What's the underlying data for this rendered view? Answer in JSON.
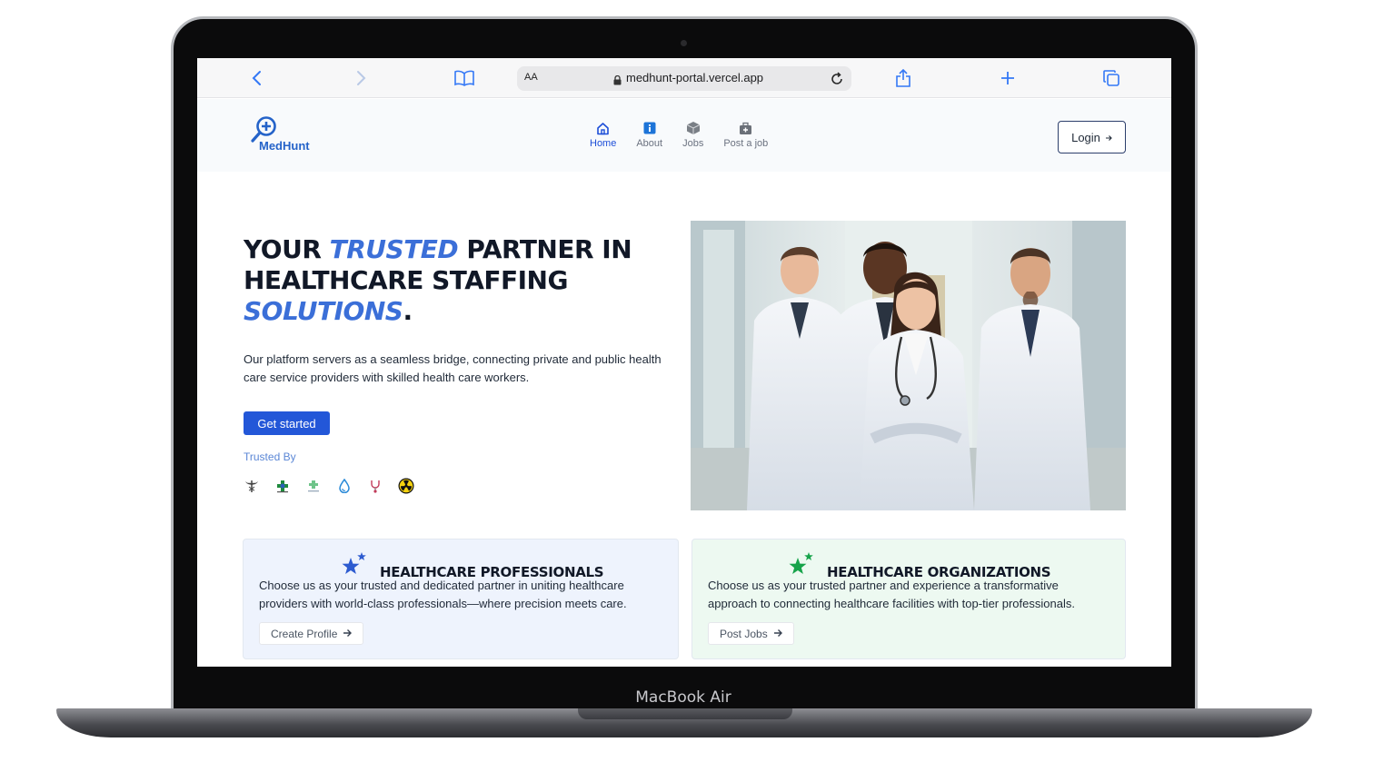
{
  "device": {
    "label": "MacBook Air"
  },
  "browser": {
    "text_size_label": "AA",
    "url": "medhunt-portal.vercel.app"
  },
  "header": {
    "logo_text": "MedHunt",
    "nav": [
      {
        "label": "Home",
        "icon": "home-icon",
        "active": true
      },
      {
        "label": "About",
        "icon": "info-icon",
        "active": false
      },
      {
        "label": "Jobs",
        "icon": "box-icon",
        "active": false
      },
      {
        "label": "Post a job",
        "icon": "briefcase-plus-icon",
        "active": false
      }
    ],
    "login_label": "Login"
  },
  "hero": {
    "title_1": "YOUR ",
    "title_accent_1": "TRUSTED",
    "title_2": " PARTNER IN HEALTHCARE STAFFING ",
    "title_accent_2": "SOLUTIONS",
    "title_end": ".",
    "description": "Our platform servers as a seamless bridge, connecting private and public health care service providers with skilled health care workers.",
    "cta_label": "Get started",
    "trusted_by_label": "Trusted By",
    "partners": [
      "caduceus-logo",
      "cross-logo",
      "pharmacy-logo",
      "drop-logo",
      "stethoscope-logo",
      "radiation-logo"
    ]
  },
  "cards": {
    "professionals": {
      "title": "HEALTHCARE PROFESSIONALS",
      "body": "Choose us as your trusted and dedicated partner in uniting healthcare providers with world-class professionals—where precision meets care.",
      "button_label": "Create Profile"
    },
    "organizations": {
      "title": "HEALTHCARE ORGANIZATIONS",
      "body": "Choose us as your trusted partner and experience a transformative approach to connecting healthcare facilities with top-tier professionals.",
      "button_label": "Post Jobs"
    }
  },
  "colors": {
    "accent_blue": "#3b6fd8",
    "button_blue": "#2357d8",
    "star_green": "#16a34a"
  }
}
